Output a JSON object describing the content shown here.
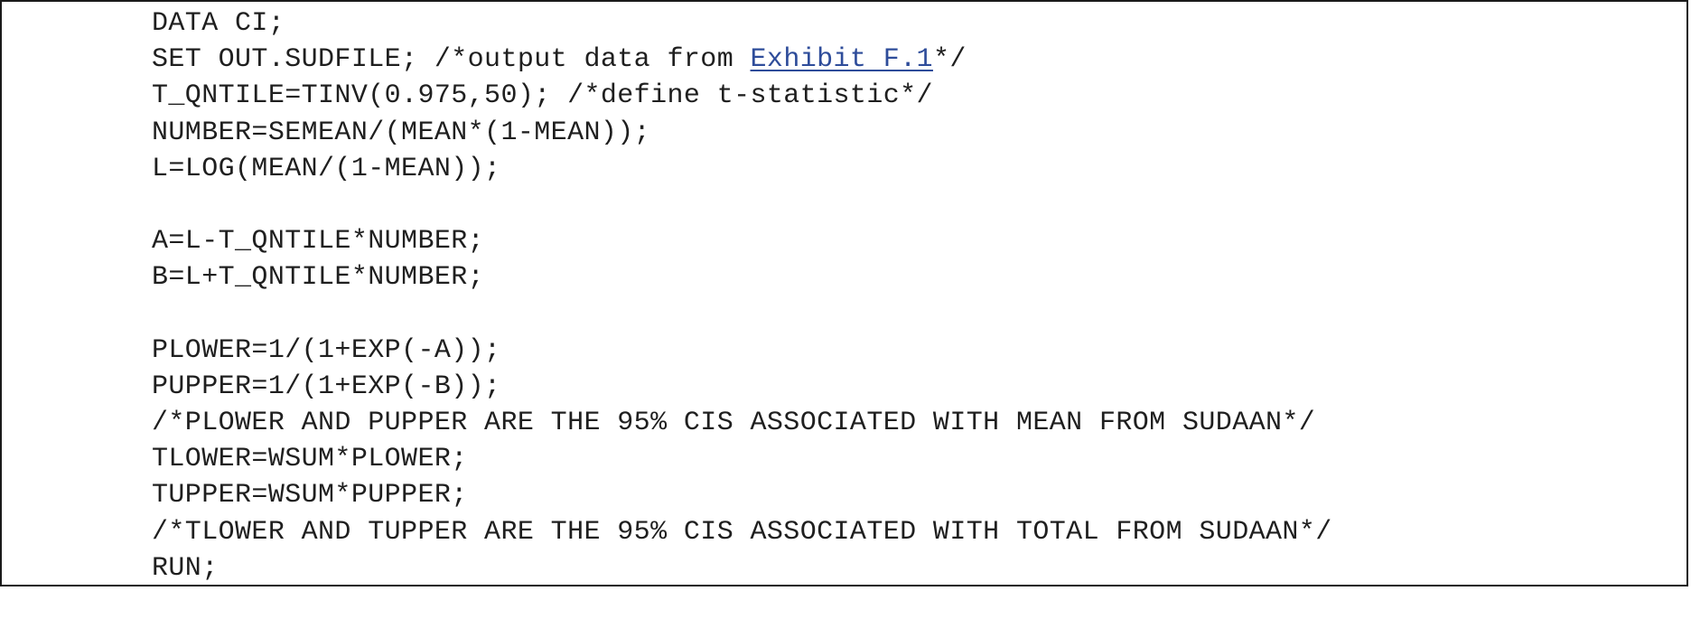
{
  "code": {
    "lines": [
      "DATA CI;",
      "SET OUT.SUDFILE; /*output data from ",
      "T_QNTILE=TINV(0.975,50); /*define t-statistic*/",
      "NUMBER=SEMEAN/(MEAN*(1-MEAN));",
      "L=LOG(MEAN/(1-MEAN));",
      "",
      "A=L-T_QNTILE*NUMBER;",
      "B=L+T_QNTILE*NUMBER;",
      "",
      "PLOWER=1/(1+EXP(-A));",
      "PUPPER=1/(1+EXP(-B));",
      "/*PLOWER AND PUPPER ARE THE 95% CIS ASSOCIATED WITH MEAN FROM SUDAAN*/",
      "TLOWER=WSUM*PLOWER;",
      "TUPPER=WSUM*PUPPER;",
      "/*TLOWER AND TUPPER ARE THE 95% CIS ASSOCIATED WITH TOTAL FROM SUDAAN*/",
      "RUN;"
    ],
    "link_text": "Exhibit F.1",
    "link_suffix": "*/"
  }
}
